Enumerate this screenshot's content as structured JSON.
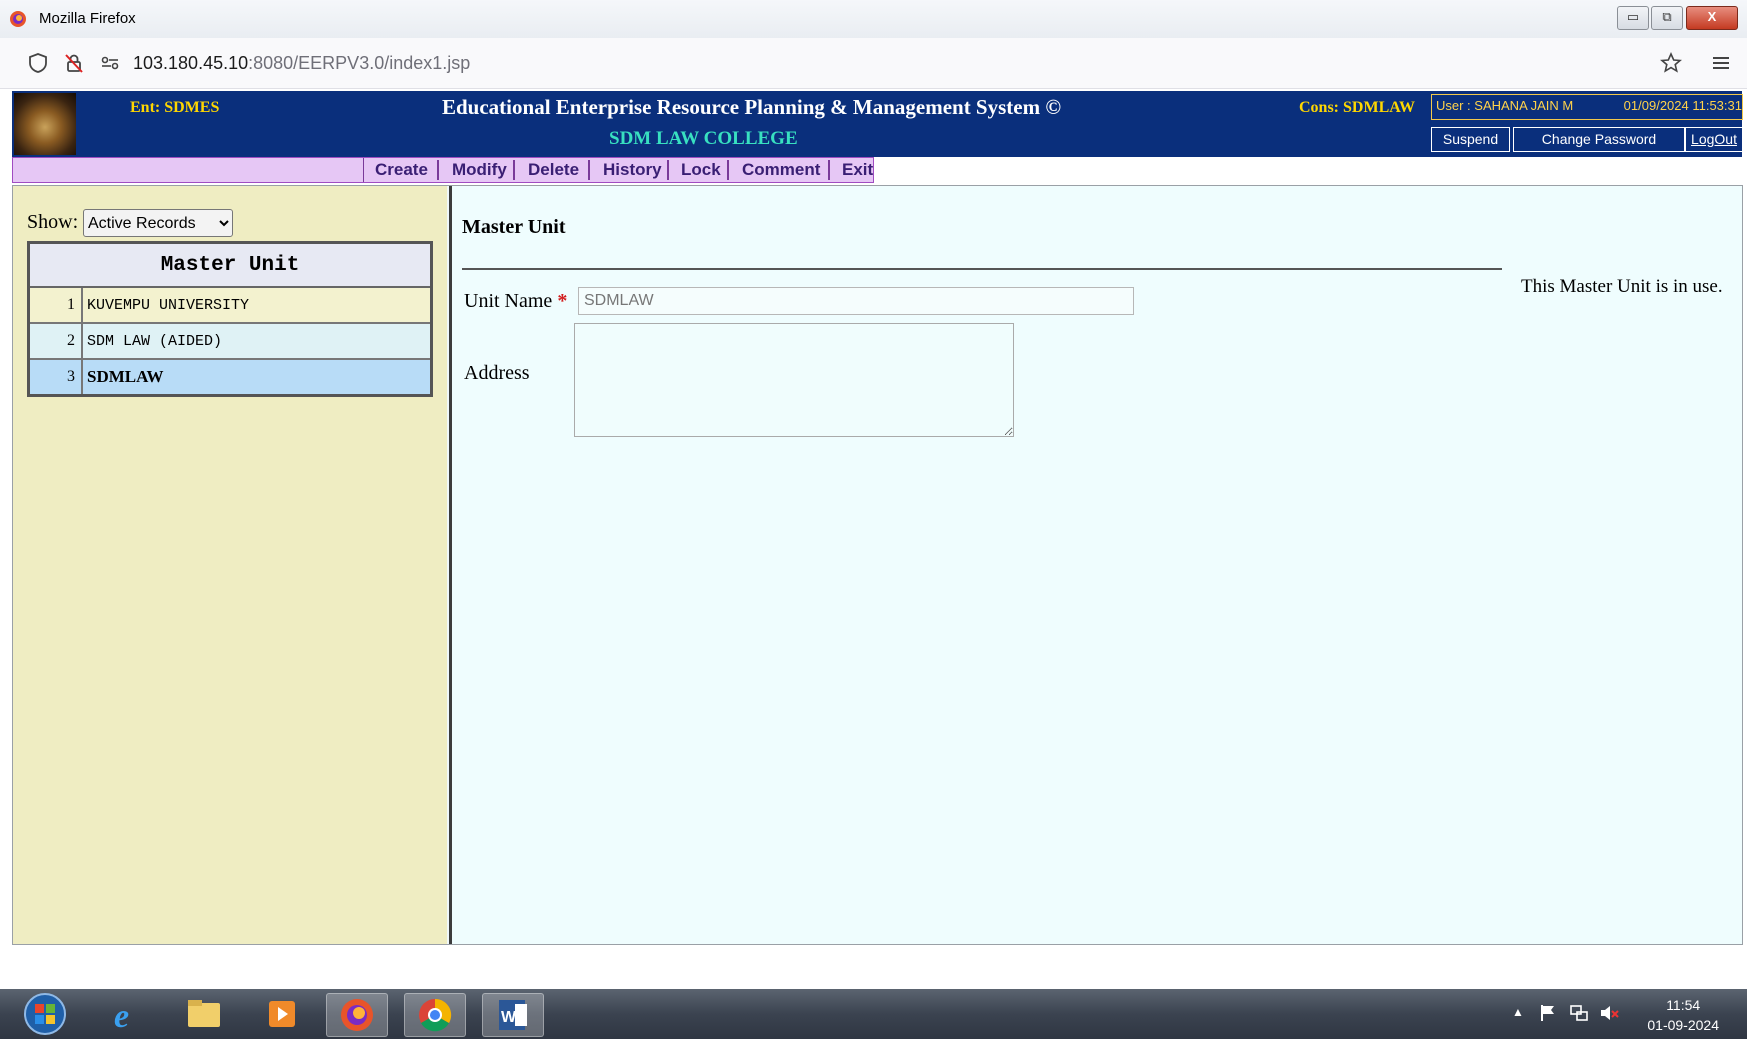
{
  "browser": {
    "window_title": "Mozilla Firefox",
    "url_host": "103.180.45.10",
    "url_path": ":8080/EERPV3.0/index1.jsp",
    "window_buttons": [
      "▭",
      "⧉",
      "X"
    ]
  },
  "header": {
    "ent_label": "Ent: SDMES",
    "system_title": "Educational Enterprise Resource Planning & Management System ©",
    "college": "SDM LAW COLLEGE",
    "cons_label": "Cons: SDMLAW",
    "user_label": "User : SAHANA JAIN M",
    "datetime": "01/09/2024 11:53:31",
    "buttons": {
      "suspend": "Suspend",
      "change_password": "Change Password",
      "logout": "LogOut"
    }
  },
  "menu": {
    "create": "Create",
    "modify": "Modify",
    "delete": "Delete",
    "history": "History",
    "lock": "Lock",
    "comment": "Comment",
    "exit": "Exit"
  },
  "left": {
    "show_label": "Show:",
    "show_selected": "Active Records",
    "table_title": "Master Unit",
    "rows": [
      {
        "num": "1",
        "name": "KUVEMPU UNIVERSITY"
      },
      {
        "num": "2",
        "name": "SDM LAW (AIDED)"
      },
      {
        "num": "3",
        "name": "SDMLAW"
      }
    ]
  },
  "form": {
    "heading": "Master Unit",
    "in_use_msg": "This Master Unit is in use.",
    "unit_name_label": "Unit Name",
    "required_mark": "*",
    "unit_name_value": "SDMLAW",
    "address_label": "Address"
  },
  "taskbar": {
    "time": "11:54",
    "date": "01-09-2024"
  },
  "colors": {
    "header_bg": "#0a2f7c",
    "menu_bg": "#e6c7f5",
    "left_bg": "#efedc2",
    "right_bg": "#effdfe",
    "selected_row": "#b8dcf7"
  }
}
